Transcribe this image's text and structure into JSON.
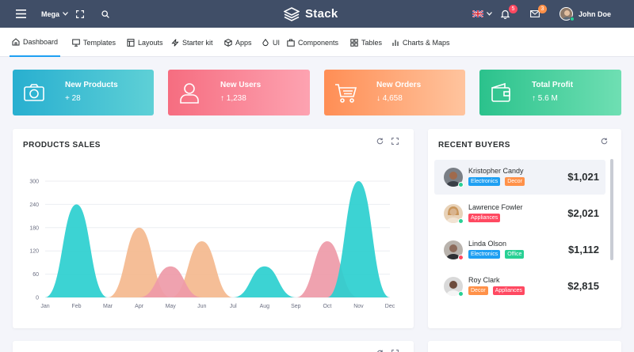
{
  "topbar": {
    "menu_label": "Mega",
    "brand": "Stack",
    "notifications_count": "5",
    "messages_count": "3",
    "user_name": "John Doe"
  },
  "nav": [
    {
      "label": "Dashboard",
      "icon": "home-icon"
    },
    {
      "label": "Templates",
      "icon": "monitor-icon"
    },
    {
      "label": "Layouts",
      "icon": "layout-icon"
    },
    {
      "label": "Starter kit",
      "icon": "zap-icon"
    },
    {
      "label": "Apps",
      "icon": "package-icon"
    },
    {
      "label": "UI",
      "icon": "droplet-icon"
    },
    {
      "label": "Components",
      "icon": "briefcase-icon"
    },
    {
      "label": "Tables",
      "icon": "grid-icon"
    },
    {
      "label": "Charts & Maps",
      "icon": "bar-chart-icon"
    }
  ],
  "stats": [
    {
      "title": "New Products",
      "value": "+ 28",
      "icon": "camera-icon",
      "colors": [
        "#28afd0",
        "#5ed0d6"
      ]
    },
    {
      "title": "New Users",
      "value": "↑ 1,238",
      "icon": "user-icon",
      "colors": [
        "#f66d80",
        "#fda3b1"
      ]
    },
    {
      "title": "New Orders",
      "value": "↓ 4,658",
      "icon": "cart-icon",
      "colors": [
        "#ff8e55",
        "#ffc49e"
      ]
    },
    {
      "title": "Total Profit",
      "value": "↑ 5.6 M",
      "icon": "wallet-icon",
      "colors": [
        "#2bc28c",
        "#6fdfb3"
      ]
    }
  ],
  "products_sales": {
    "title": "PRODUCTS SALES"
  },
  "chart_data": {
    "type": "area",
    "categories": [
      "Jan",
      "Feb",
      "Mar",
      "Apr",
      "May",
      "Jun",
      "Jul",
      "Aug",
      "Sep",
      "Oct",
      "Nov",
      "Dec"
    ],
    "ylim": [
      0,
      300
    ],
    "yticks": [
      0,
      60,
      120,
      180,
      240,
      300
    ],
    "series": [
      {
        "color": "#f4b98e",
        "peaks": [
          {
            "x": 3,
            "y": 180
          },
          {
            "x": 5,
            "y": 145
          }
        ],
        "base": [
          [
            2,
            0
          ],
          [
            6,
            0
          ]
        ]
      },
      {
        "color": "#ee9aa8",
        "peaks": [
          {
            "x": 4,
            "y": 80
          },
          {
            "x": 9,
            "y": 145
          }
        ],
        "base": [
          [
            3,
            0
          ],
          [
            5,
            0
          ],
          [
            8,
            0
          ],
          [
            10,
            0
          ]
        ]
      },
      {
        "color": "#2bcfcf",
        "peaks": [
          {
            "x": 1,
            "y": 240
          },
          {
            "x": 7,
            "y": 80
          },
          {
            "x": 10,
            "y": 300
          }
        ],
        "base": [
          [
            0,
            0
          ],
          [
            2,
            0
          ],
          [
            6,
            0
          ],
          [
            8,
            0
          ],
          [
            9,
            0
          ],
          [
            11,
            0
          ]
        ]
      }
    ]
  },
  "recent_buyers": {
    "title": "RECENT BUYERS",
    "items": [
      {
        "name": "Kristopher Candy",
        "amount": "$1,021",
        "tags": [
          {
            "label": "Electronics",
            "color": "#1e9ff2"
          },
          {
            "label": "Decor",
            "color": "#ff9149"
          }
        ],
        "status_color": "#28d094",
        "skin": "#a06a4c"
      },
      {
        "name": "Lawrence Fowler",
        "amount": "$2,021",
        "tags": [
          {
            "label": "Appliances",
            "color": "#ff4961"
          }
        ],
        "status_color": "#28d094",
        "skin": "#d9b48f"
      },
      {
        "name": "Linda Olson",
        "amount": "$1,112",
        "tags": [
          {
            "label": "Electronics",
            "color": "#1e9ff2"
          },
          {
            "label": "Office",
            "color": "#28d094"
          }
        ],
        "status_color": "#ff4961",
        "skin": "#8c6a5a"
      },
      {
        "name": "Roy Clark",
        "amount": "$2,815",
        "tags": [
          {
            "label": "Decor",
            "color": "#ff9149"
          },
          {
            "label": "Appliances",
            "color": "#ff4961"
          }
        ],
        "status_color": "#28d094",
        "skin": "#6d4c3d"
      }
    ]
  },
  "colors": {
    "topbar": "#404e67",
    "accent": "#1e9ff2"
  }
}
